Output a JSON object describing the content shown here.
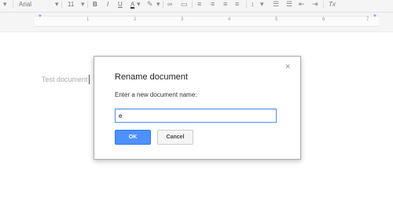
{
  "toolbar": {
    "font": "Arial",
    "size": "11",
    "bold": "B",
    "italic": "I",
    "underline": "U",
    "text_color": "A",
    "clear": "Tx"
  },
  "ruler": {
    "ticks": [
      "1",
      "1",
      "2",
      "3",
      "4",
      "5",
      "6",
      "7"
    ]
  },
  "document": {
    "title": "Test document"
  },
  "dialog": {
    "title": "Rename document",
    "close": "×",
    "label": "Enter a new document name:",
    "input_value": "e",
    "ok_label": "OK",
    "cancel_label": "Cancel"
  },
  "colors": {
    "accent": "#4d90fe",
    "dialog_border": "#acacac"
  }
}
